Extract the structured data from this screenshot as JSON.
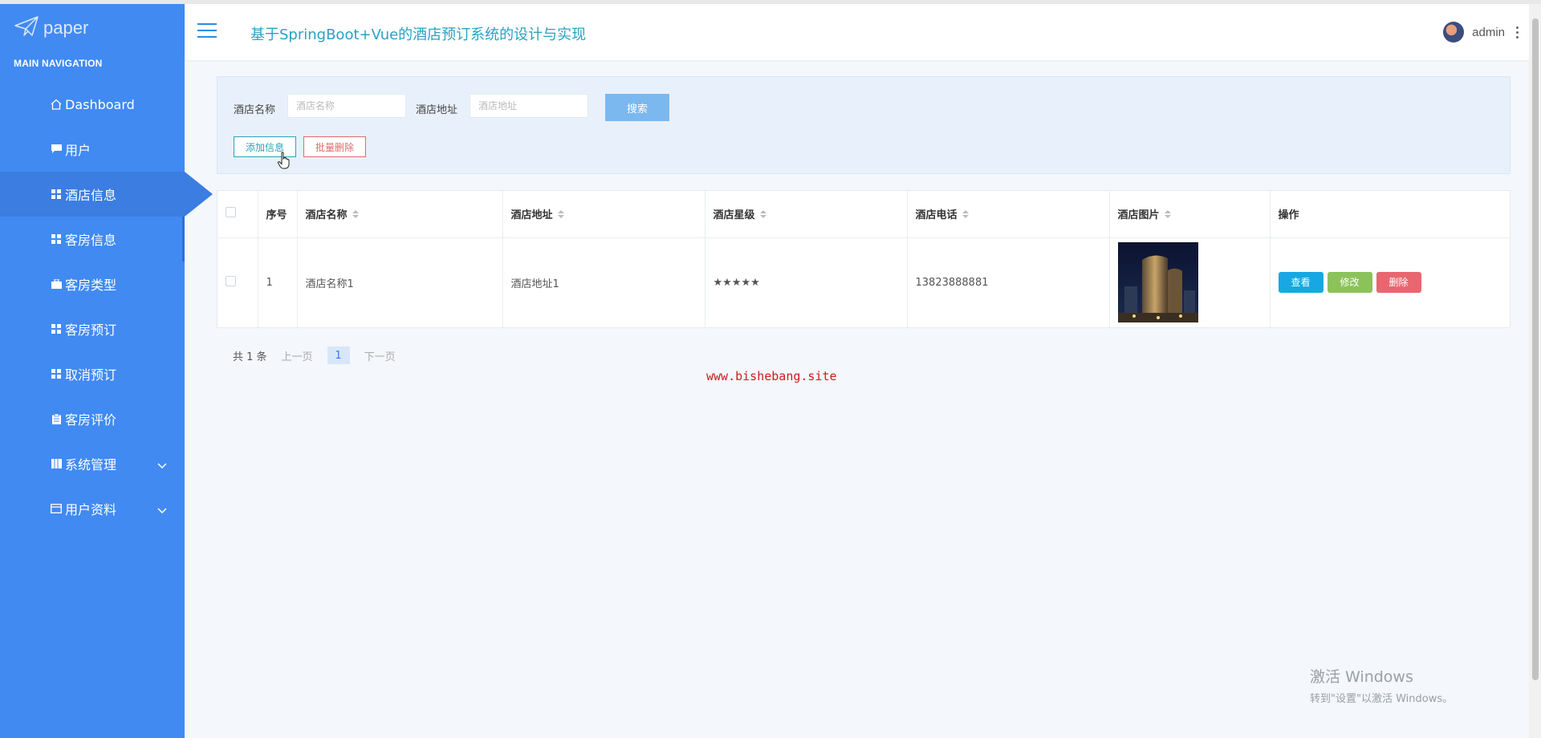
{
  "app": {
    "logo_text": "paper",
    "title": "基于SpringBoot+Vue的酒店预订系统的设计与实现",
    "user": "admin"
  },
  "sidebar": {
    "heading": "MAIN NAVIGATION",
    "items": [
      {
        "label": "Dashboard",
        "icon": "home-icon"
      },
      {
        "label": "用户",
        "icon": "chat-icon"
      },
      {
        "label": "酒店信息",
        "icon": "grid-icon",
        "active": true
      },
      {
        "label": "客房信息",
        "icon": "grid-icon"
      },
      {
        "label": "客房类型",
        "icon": "briefcase-icon"
      },
      {
        "label": "客房预订",
        "icon": "grid-icon"
      },
      {
        "label": "取消预订",
        "icon": "grid-icon"
      },
      {
        "label": "客房评价",
        "icon": "clipboard-icon"
      },
      {
        "label": "系统管理",
        "icon": "book-icon",
        "expandable": true
      },
      {
        "label": "用户资料",
        "icon": "card-icon",
        "expandable": true
      }
    ]
  },
  "search": {
    "name_label": "酒店名称",
    "name_placeholder": "酒店名称",
    "address_label": "酒店地址",
    "address_placeholder": "酒店地址",
    "search_button": "搜索",
    "add_button": "添加信息",
    "batch_delete_button": "批量删除"
  },
  "table": {
    "columns": [
      "序号",
      "酒店名称",
      "酒店地址",
      "酒店星级",
      "酒店电话",
      "酒店图片",
      "操作"
    ],
    "rows": [
      {
        "index": "1",
        "name": "酒店名称1",
        "address": "酒店地址1",
        "stars": "★★★★★",
        "phone": "13823888881"
      }
    ],
    "actions": {
      "view": "查看",
      "edit": "修改",
      "delete": "删除"
    }
  },
  "pagination": {
    "total": "共 1 条",
    "prev": "上一页",
    "current": "1",
    "next": "下一页"
  },
  "watermark": "www.bishebang.site",
  "os_notice": {
    "line1": "激活 Windows",
    "line2": "转到\"设置\"以激活 Windows。"
  },
  "colors": {
    "sidebar": "#418af2",
    "accent": "#2ba2bd",
    "danger": "#e86670"
  }
}
